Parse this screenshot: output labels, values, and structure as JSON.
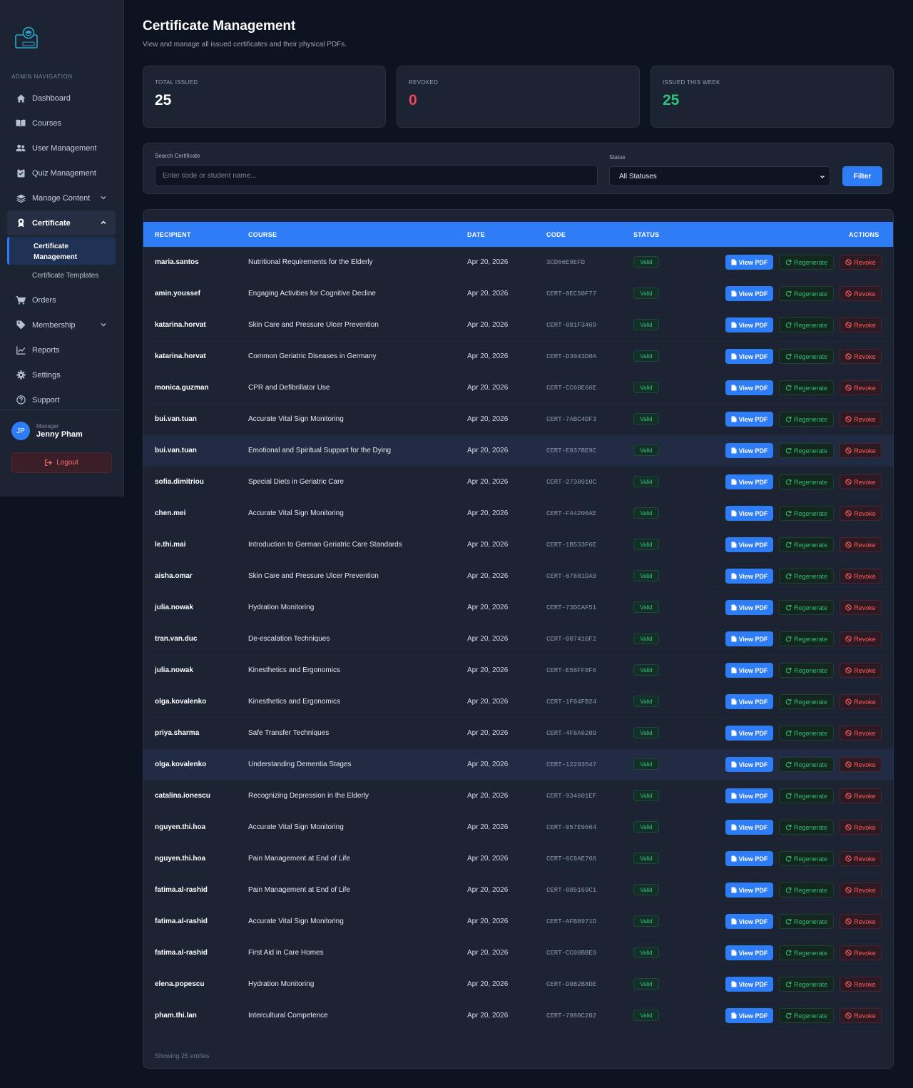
{
  "sidebar": {
    "heading": "ADMIN NAVIGATION",
    "items": [
      {
        "label": "Dashboard",
        "icon": "home-icon"
      },
      {
        "label": "Courses",
        "icon": "book-icon"
      },
      {
        "label": "User Management",
        "icon": "users-icon"
      },
      {
        "label": "Quiz Management",
        "icon": "clipboard-icon"
      },
      {
        "label": "Manage Content",
        "icon": "layers-icon"
      },
      {
        "label": "Certificate",
        "icon": "award-icon"
      },
      {
        "label": "Orders",
        "icon": "cart-icon"
      },
      {
        "label": "Membership",
        "icon": "tag-icon"
      },
      {
        "label": "Reports",
        "icon": "chart-line-icon"
      },
      {
        "label": "Settings",
        "icon": "gear-icon"
      },
      {
        "label": "Support",
        "icon": "help-icon"
      }
    ],
    "certificate_sub": {
      "active_line1": "Certificate",
      "active_line2": "Management",
      "templates": "Certificate Templates"
    },
    "user": {
      "initials": "JP",
      "role": "Manager",
      "name": "Jenny Pham"
    },
    "logout": "Logout"
  },
  "page": {
    "title": "Certificate Management",
    "subtitle": "View and manage all issued certificates and their physical PDFs."
  },
  "stats": [
    {
      "label": "TOTAL ISSUED",
      "value": "25",
      "color": "#ffffff"
    },
    {
      "label": "REVOKED",
      "value": "0",
      "color": "#f0455a"
    },
    {
      "label": "ISSUED THIS WEEK",
      "value": "25",
      "color": "#2fc27c"
    }
  ],
  "filter": {
    "search_label": "Search Certificate",
    "search_placeholder": "Enter code or student name...",
    "status_label": "Status",
    "status_value": "All Statuses",
    "button": "Filter"
  },
  "table": {
    "headers": [
      "RECIPIENT",
      "COURSE",
      "DATE",
      "CODE",
      "STATUS",
      "ACTIONS"
    ],
    "actions": {
      "view": "View PDF",
      "regenerate": "Regenerate",
      "revoke": "Revoke"
    },
    "rows": [
      {
        "recipient": "maria.santos",
        "course": "Nutritional Requirements for the Elderly",
        "date": "Apr 20, 2026",
        "code": "3CD66E9EFD",
        "status": "Valid"
      },
      {
        "recipient": "amin.youssef",
        "course": "Engaging Activities for Cognitive Decline",
        "date": "Apr 20, 2026",
        "code": "CERT-8EC50F77",
        "status": "Valid"
      },
      {
        "recipient": "katarina.horvat",
        "course": "Skin Care and Pressure Ulcer Prevention",
        "date": "Apr 20, 2026",
        "code": "CERT-881F3469",
        "status": "Valid"
      },
      {
        "recipient": "katarina.horvat",
        "course": "Common Geriatric Diseases in Germany",
        "date": "Apr 20, 2026",
        "code": "CERT-D3043D0A",
        "status": "Valid"
      },
      {
        "recipient": "monica.guzman",
        "course": "CPR and Defibrillator Use",
        "date": "Apr 20, 2026",
        "code": "CERT-CC60E66E",
        "status": "Valid"
      },
      {
        "recipient": "bui.van.tuan",
        "course": "Accurate Vital Sign Monitoring",
        "date": "Apr 20, 2026",
        "code": "CERT-7ABC4DF3",
        "status": "Valid"
      },
      {
        "recipient": "bui.van.tuan",
        "course": "Emotional and Spiritual Support for the Dying",
        "date": "Apr 20, 2026",
        "code": "CERT-E837BE9C",
        "status": "Valid",
        "highlight": true
      },
      {
        "recipient": "sofia.dimitriou",
        "course": "Special Diets in Geriatric Care",
        "date": "Apr 20, 2026",
        "code": "CERT-2738910C",
        "status": "Valid"
      },
      {
        "recipient": "chen.mei",
        "course": "Accurate Vital Sign Monitoring",
        "date": "Apr 20, 2026",
        "code": "CERT-F44206AE",
        "status": "Valid"
      },
      {
        "recipient": "le.thi.mai",
        "course": "Introduction to German Geriatric Care Standards",
        "date": "Apr 20, 2026",
        "code": "CERT-1B533F6E",
        "status": "Valid"
      },
      {
        "recipient": "aisha.omar",
        "course": "Skin Care and Pressure Ulcer Prevention",
        "date": "Apr 20, 2026",
        "code": "CERT-67881DA9",
        "status": "Valid"
      },
      {
        "recipient": "julia.nowak",
        "course": "Hydration Monitoring",
        "date": "Apr 20, 2026",
        "code": "CERT-73DCAF51",
        "status": "Valid"
      },
      {
        "recipient": "tran.van.duc",
        "course": "De-escalation Techniques",
        "date": "Apr 20, 2026",
        "code": "CERT-007410F2",
        "status": "Valid"
      },
      {
        "recipient": "julia.nowak",
        "course": "Kinesthetics and Ergonomics",
        "date": "Apr 20, 2026",
        "code": "CERT-E58FF8F6",
        "status": "Valid"
      },
      {
        "recipient": "olga.kovalenko",
        "course": "Kinesthetics and Ergonomics",
        "date": "Apr 20, 2026",
        "code": "CERT-1F04FB24",
        "status": "Valid"
      },
      {
        "recipient": "priya.sharma",
        "course": "Safe Transfer Techniques",
        "date": "Apr 20, 2026",
        "code": "CERT-4F6A6209",
        "status": "Valid"
      },
      {
        "recipient": "olga.kovalenko",
        "course": "Understanding Dementia Stages",
        "date": "Apr 20, 2026",
        "code": "CERT-12293547",
        "status": "Valid",
        "highlight": true
      },
      {
        "recipient": "catalina.ionescu",
        "course": "Recognizing Depression in the Elderly",
        "date": "Apr 20, 2026",
        "code": "CERT-934601EF",
        "status": "Valid"
      },
      {
        "recipient": "nguyen.thi.hoa",
        "course": "Accurate Vital Sign Monitoring",
        "date": "Apr 20, 2026",
        "code": "CERT-057E9664",
        "status": "Valid"
      },
      {
        "recipient": "nguyen.thi.hoa",
        "course": "Pain Management at End of Life",
        "date": "Apr 20, 2026",
        "code": "CERT-6C9AE766",
        "status": "Valid"
      },
      {
        "recipient": "fatima.al-rashid",
        "course": "Pain Management at End of Life",
        "date": "Apr 20, 2026",
        "code": "CERT-885169C1",
        "status": "Valid"
      },
      {
        "recipient": "fatima.al-rashid",
        "course": "Accurate Vital Sign Monitoring",
        "date": "Apr 20, 2026",
        "code": "CERT-AFB8971D",
        "status": "Valid"
      },
      {
        "recipient": "fatima.al-rashid",
        "course": "First Aid in Care Homes",
        "date": "Apr 20, 2026",
        "code": "CERT-CC08BBE9",
        "status": "Valid"
      },
      {
        "recipient": "elena.popescu",
        "course": "Hydration Monitoring",
        "date": "Apr 20, 2026",
        "code": "CERT-D0B2B8DE",
        "status": "Valid"
      },
      {
        "recipient": "pham.thi.lan",
        "course": "Intercultural Competence",
        "date": "Apr 20, 2026",
        "code": "CERT-7980C202",
        "status": "Valid"
      }
    ],
    "footer": "Showing 25 entries"
  }
}
